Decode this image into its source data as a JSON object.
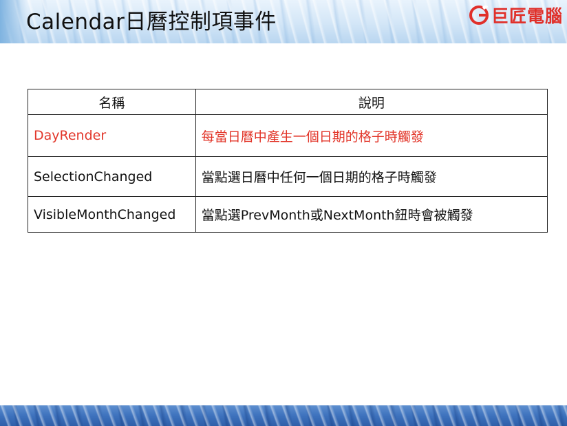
{
  "slide": {
    "title": "Calendar日曆控制項事件",
    "logo_text": "巨匠電腦",
    "brand_color": "#e0302a"
  },
  "table": {
    "headers": [
      "名稱",
      "說明"
    ],
    "rows": [
      {
        "name": "DayRender",
        "description": "每當日曆中產生一個日期的格子時觸發",
        "highlight": "#e2362a"
      },
      {
        "name": "SelectionChanged",
        "description": "當點選日曆中任何一個日期的格子時觸發"
      },
      {
        "name": "VisibleMonthChanged",
        "description": "當點選PrevMonth或NextMonth鈕時會被觸發"
      }
    ]
  }
}
